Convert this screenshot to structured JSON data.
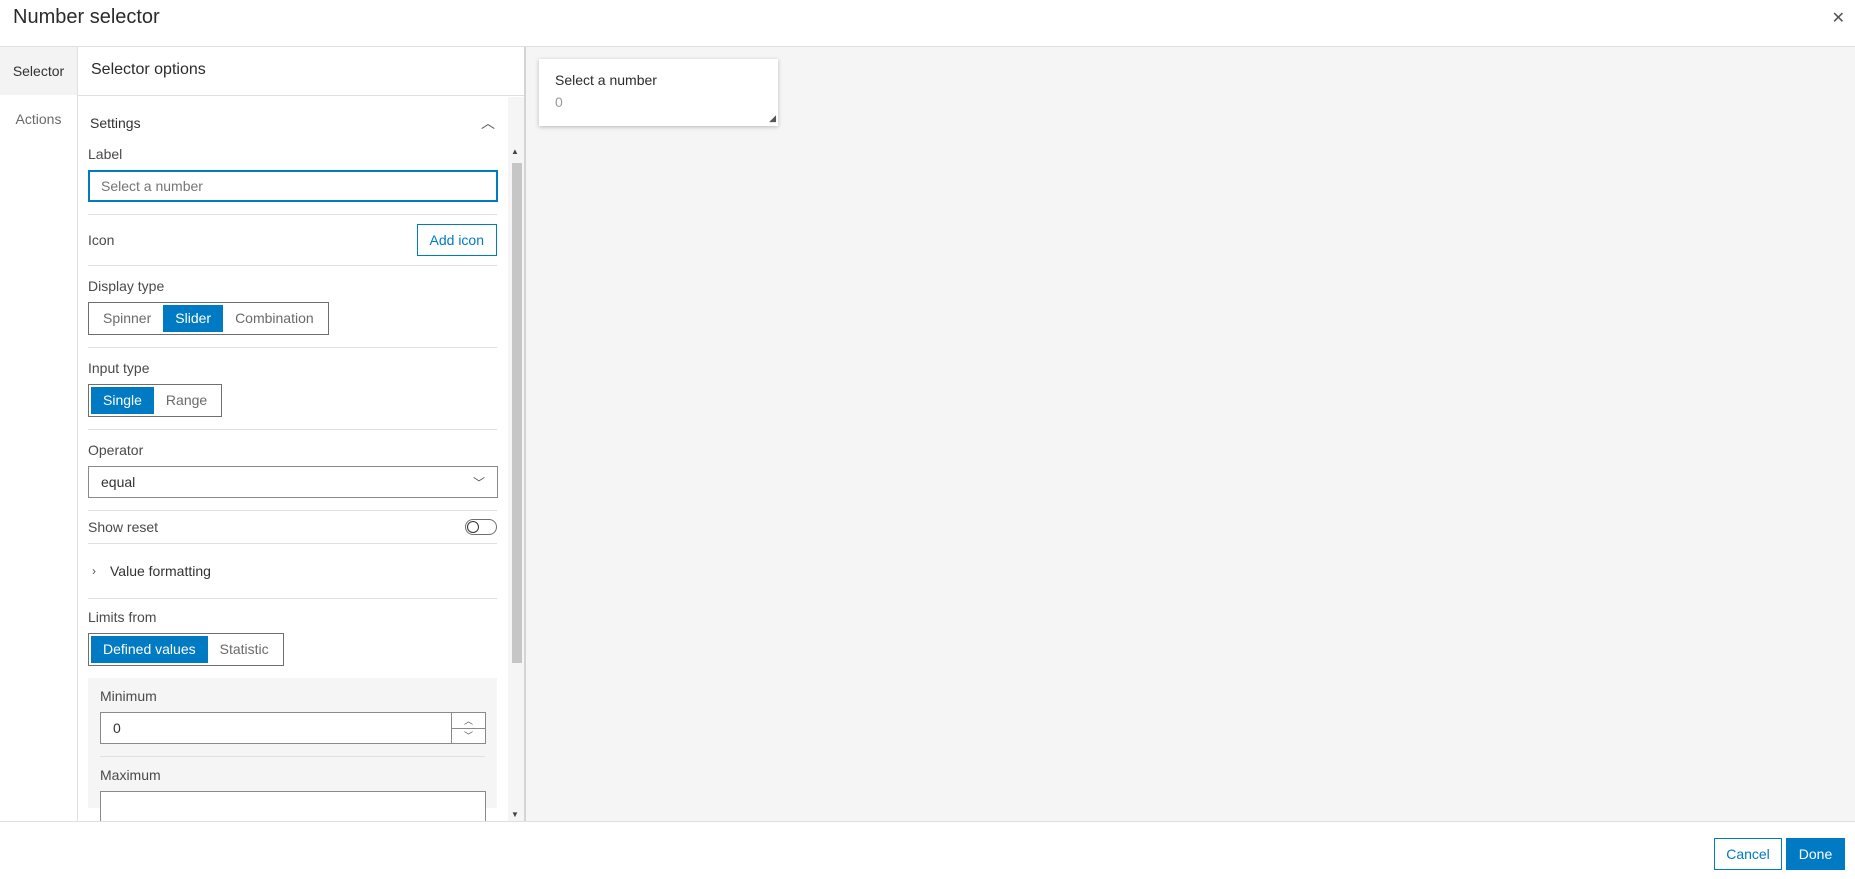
{
  "window": {
    "title": "Number selector",
    "close_glyph": "✕",
    "close_icon": "close-icon"
  },
  "nav": {
    "items": [
      {
        "label": "Selector",
        "active": true
      },
      {
        "label": "Actions",
        "active": false
      }
    ]
  },
  "panel": {
    "title": "Selector options",
    "settings_label": "Settings",
    "label_field": {
      "label": "Label",
      "placeholder": "Select a number",
      "value": ""
    },
    "icon_row": {
      "label": "Icon",
      "button": "Add icon"
    },
    "display_type": {
      "label": "Display type",
      "options": [
        "Spinner",
        "Slider",
        "Combination"
      ],
      "selected": "Slider"
    },
    "input_type": {
      "label": "Input type",
      "options": [
        "Single",
        "Range"
      ],
      "selected": "Single"
    },
    "operator": {
      "label": "Operator",
      "value": "equal"
    },
    "show_reset": {
      "label": "Show reset",
      "on": false
    },
    "value_formatting": {
      "label": "Value formatting"
    },
    "limits_from": {
      "label": "Limits from",
      "options": [
        "Defined values",
        "Statistic"
      ],
      "selected": "Defined values"
    },
    "minimum": {
      "label": "Minimum",
      "value": "0"
    },
    "maximum": {
      "label": "Maximum"
    }
  },
  "preview": {
    "label": "Select a number",
    "value": "0"
  },
  "footer": {
    "cancel": "Cancel",
    "done": "Done"
  },
  "colors": {
    "accent": "#007ac2",
    "canvas_bg": "#f5f5f5"
  }
}
